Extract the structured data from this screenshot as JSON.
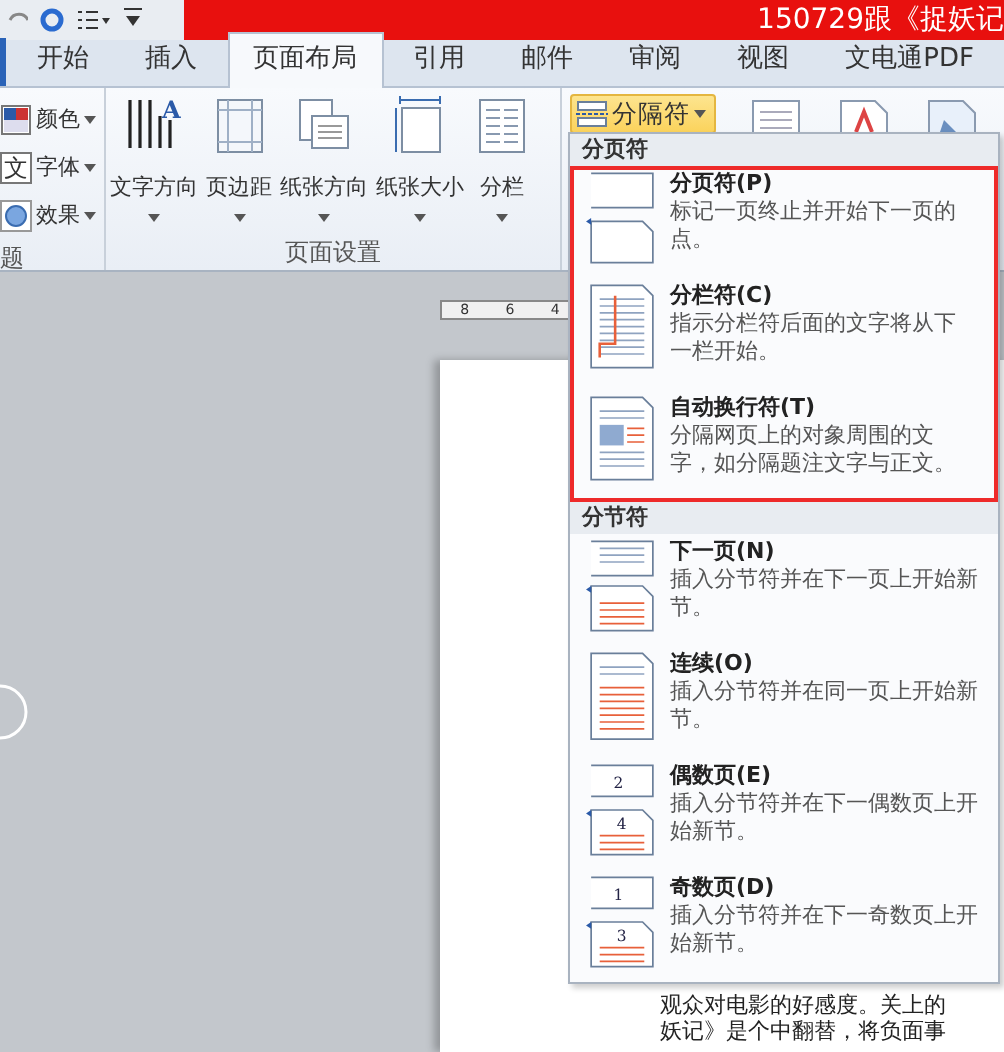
{
  "title_bar": {
    "title": "150729跟《捉妖记"
  },
  "tabs": [
    {
      "label": "开始",
      "selected": false
    },
    {
      "label": "插入",
      "selected": false
    },
    {
      "label": "页面布局",
      "selected": true
    },
    {
      "label": "引用",
      "selected": false
    },
    {
      "label": "邮件",
      "selected": false
    },
    {
      "label": "审阅",
      "selected": false
    },
    {
      "label": "视图",
      "selected": false
    },
    {
      "label": "文电通PDF",
      "selected": false
    }
  ],
  "theme_group": {
    "label": "题",
    "items": [
      {
        "kind": "colors",
        "label": "颜色"
      },
      {
        "kind": "fonts",
        "label": "字体",
        "icon_text": "文"
      },
      {
        "kind": "effects",
        "label": "效果"
      }
    ]
  },
  "page_setup_group": {
    "label": "页面设置",
    "buttons": [
      {
        "kind": "text-direction",
        "label": "文字方向",
        "icon_text": "A"
      },
      {
        "kind": "margins",
        "label": "页边距"
      },
      {
        "kind": "orientation",
        "label": "纸张方向"
      },
      {
        "kind": "size",
        "label": "纸张大小"
      },
      {
        "kind": "columns",
        "label": "分栏"
      }
    ]
  },
  "breaks_button": {
    "label": "分隔符",
    "highlighted": true
  },
  "ruler": {
    "numbers": [
      "8",
      "6",
      "4"
    ]
  },
  "breaks_menu": {
    "sections": [
      {
        "header": "分页符",
        "outlined": true,
        "items": [
          {
            "kind": "page-break",
            "title": "分页符(P)",
            "description": "标记一页终止并开始下一页的点。"
          },
          {
            "kind": "column-break",
            "title": "分栏符(C)",
            "description": "指示分栏符后面的文字将从下一栏开始。"
          },
          {
            "kind": "text-wrapping",
            "title": "自动换行符(T)",
            "description": "分隔网页上的对象周围的文字，如分隔题注文字与正文。"
          }
        ]
      },
      {
        "header": "分节符",
        "outlined": false,
        "items": [
          {
            "kind": "next-page",
            "title": "下一页(N)",
            "description": "插入分节符并在下一页上开始新节。"
          },
          {
            "kind": "continuous",
            "title": "连续(O)",
            "description": "插入分节符并在同一页上开始新节。"
          },
          {
            "kind": "even-page",
            "title": "偶数页(E)",
            "description": "插入分节符并在下一偶数页上开始新节。",
            "icon_numbers": [
              "2",
              "4"
            ]
          },
          {
            "kind": "odd-page",
            "title": "奇数页(D)",
            "description": "插入分节符并在下一奇数页上开始新节。",
            "icon_numbers": [
              "1",
              "3"
            ]
          }
        ]
      }
    ]
  },
  "document": {
    "lines": [
      "观众对电影的好感度。关上的",
      "妖记》是个中翻替，将负面事"
    ]
  }
}
